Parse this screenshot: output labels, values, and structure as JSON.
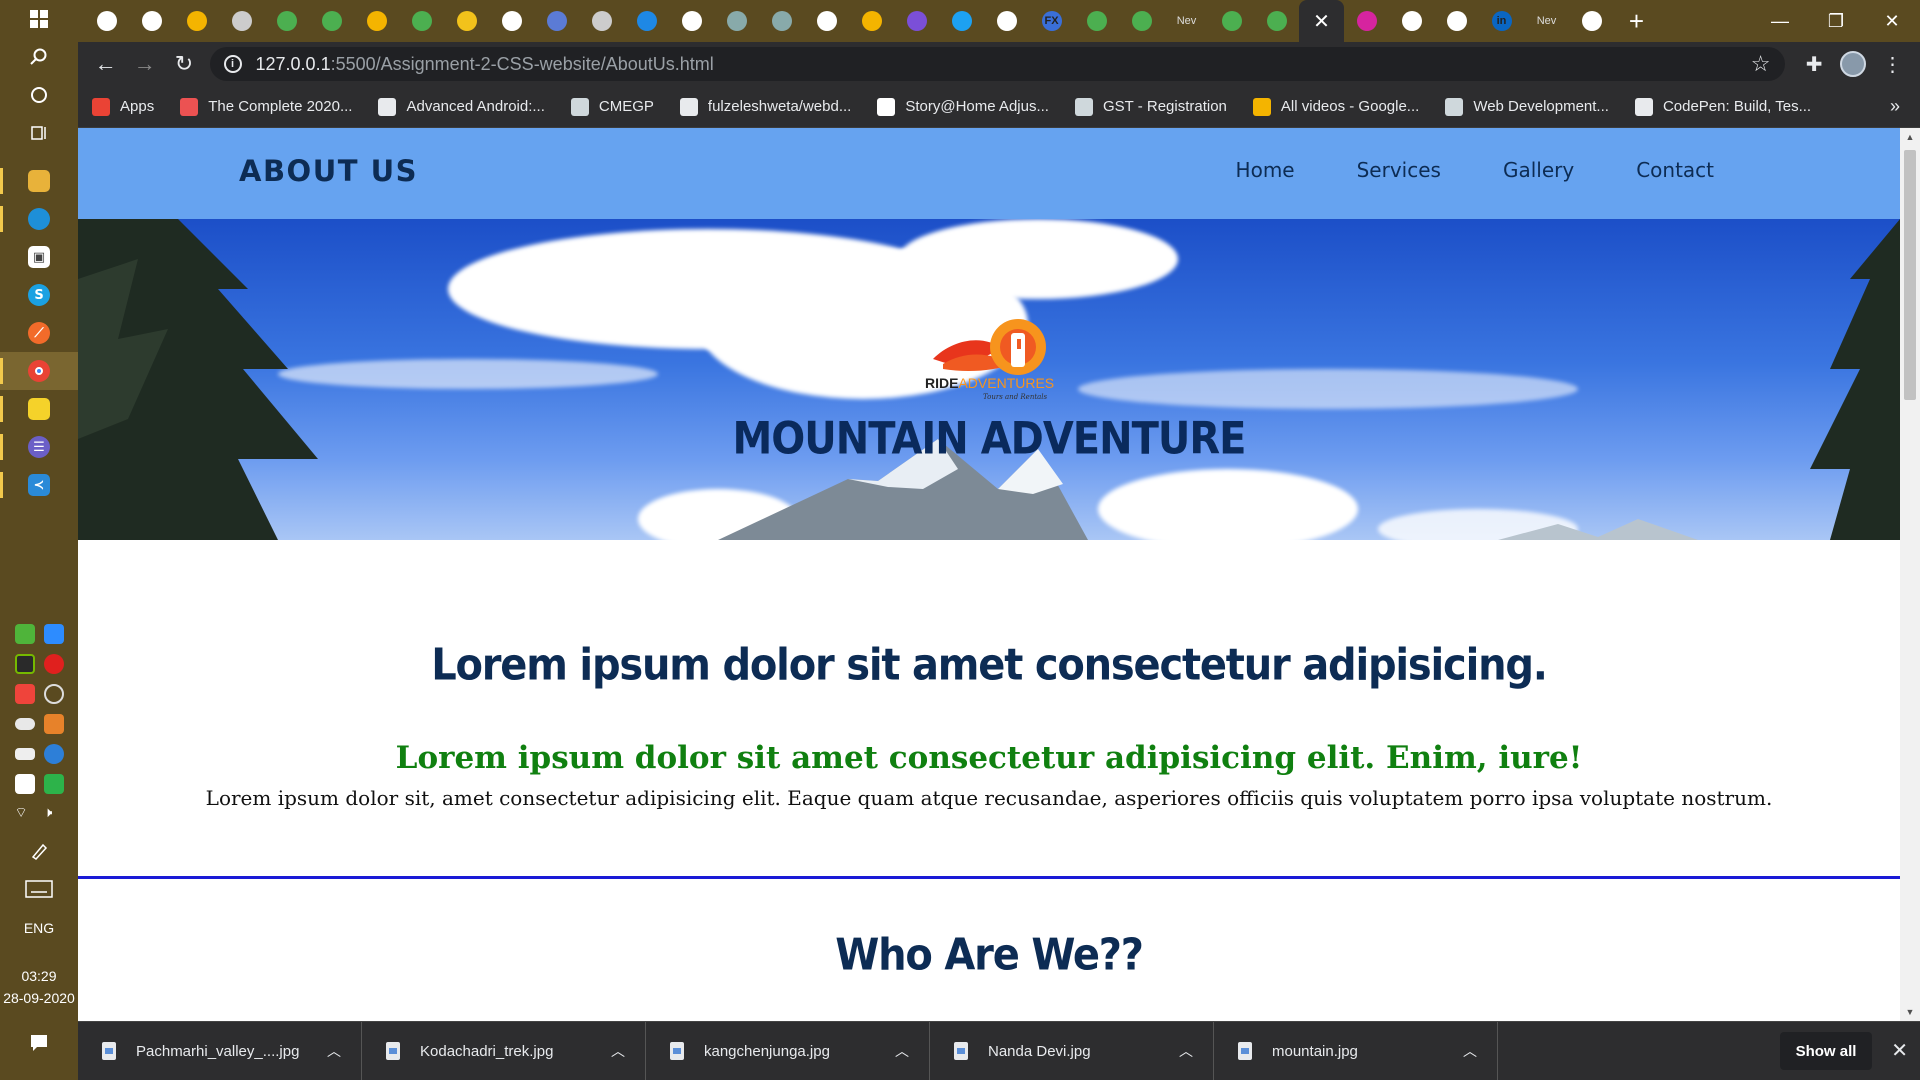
{
  "browser": {
    "url_host": "127.0.0.1",
    "url_path": ":5500/Assignment-2-CSS-website/AboutUs.html",
    "tabs": [
      {
        "icon": "codepen-icon",
        "label": ""
      },
      {
        "icon": "codepen-icon",
        "label": ""
      },
      {
        "icon": "drive-icon",
        "label": ""
      },
      {
        "icon": "page-icon",
        "label": ""
      },
      {
        "icon": "w3-icon",
        "label": ""
      },
      {
        "icon": "w3-icon",
        "label": ""
      },
      {
        "icon": "drive-icon",
        "label": ""
      },
      {
        "icon": "w3-icon",
        "label": ""
      },
      {
        "icon": "classroom-icon",
        "label": ""
      },
      {
        "icon": "gmail-icon",
        "label": ""
      },
      {
        "icon": "meet-icon",
        "label": ""
      },
      {
        "icon": "page-icon",
        "label": ""
      },
      {
        "icon": "figma-icon",
        "label": ""
      },
      {
        "icon": "wordpress-icon",
        "label": ""
      },
      {
        "icon": "gear-icon",
        "label": ""
      },
      {
        "icon": "gear-icon",
        "label": ""
      },
      {
        "icon": "wordpress-icon",
        "label": ""
      },
      {
        "icon": "drive-icon",
        "label": ""
      },
      {
        "icon": "pen-icon",
        "label": ""
      },
      {
        "icon": "twitter-icon",
        "label": ""
      },
      {
        "icon": "codepen-icon",
        "label": ""
      },
      {
        "icon": "fx-icon",
        "label": "FX"
      },
      {
        "icon": "w3-icon",
        "label": ""
      },
      {
        "icon": "w3-icon",
        "label": ""
      },
      {
        "icon": "text-icon",
        "label": "Nev"
      },
      {
        "icon": "w3-icon",
        "label": ""
      },
      {
        "icon": "w3-icon",
        "label": ""
      }
    ],
    "tabs_after": [
      {
        "icon": "instagram-icon",
        "label": ""
      },
      {
        "icon": "google-icon",
        "label": ""
      },
      {
        "icon": "codepen-icon",
        "label": ""
      },
      {
        "icon": "linkedin-icon",
        "label": "in"
      },
      {
        "icon": "text-icon",
        "label": "Nev"
      },
      {
        "icon": "google-icon",
        "label": ""
      }
    ],
    "bookmarks": [
      {
        "label": "Apps",
        "icon": "apps-grid-icon"
      },
      {
        "label": "The Complete 2020...",
        "icon": "udemy-icon"
      },
      {
        "label": "Advanced Android:...",
        "icon": "android-icon"
      },
      {
        "label": "CMEGP",
        "icon": "page-icon"
      },
      {
        "label": "fulzeleshweta/webd...",
        "icon": "github-icon"
      },
      {
        "label": "Story@Home Adjus...",
        "icon": "amazon-icon"
      },
      {
        "label": "GST - Registration",
        "icon": "page-icon"
      },
      {
        "label": "All videos - Google...",
        "icon": "drive-icon"
      },
      {
        "label": "Web Development...",
        "icon": "page-icon"
      },
      {
        "label": "CodePen: Build, Tes...",
        "icon": "codepen-icon"
      }
    ]
  },
  "site": {
    "page_title": "ABOUT US",
    "nav": [
      "Home",
      "Services",
      "Gallery",
      "Contact"
    ],
    "hero_logo_text_1": "RIDE",
    "hero_logo_text_2": "ADVENTURES",
    "hero_logo_tagline": "Tours and Rentals",
    "hero_title": "MOUNTAIN ADVENTURE",
    "heading": "Lorem ipsum dolor sit amet consectetur adipisicing.",
    "subheading": "Lorem ipsum dolor sit amet consectetur adipisicing elit. Enim, iure!",
    "paragraph": "Lorem ipsum dolor sit, amet consectetur adipisicing elit. Eaque quam atque recusandae, asperiores officiis quis voluptatem porro ipsa voluptate nostrum.",
    "section_heading": "Who Are We??"
  },
  "downloads": {
    "items": [
      "Pachmarhi_valley_....jpg",
      "Kodachadri_trek.jpg",
      "kangchenjunga.jpg",
      "Nanda Devi.jpg",
      "mountain.jpg"
    ],
    "show_all": "Show all"
  },
  "taskbar": {
    "language": "ENG",
    "time": "03:29",
    "date": "28-09-2020"
  },
  "colors": {
    "header_bg": "#66a3f0",
    "title_navy": "#0d2c54",
    "subheading_green": "#108010",
    "divider_blue": "#1a1ad6"
  }
}
